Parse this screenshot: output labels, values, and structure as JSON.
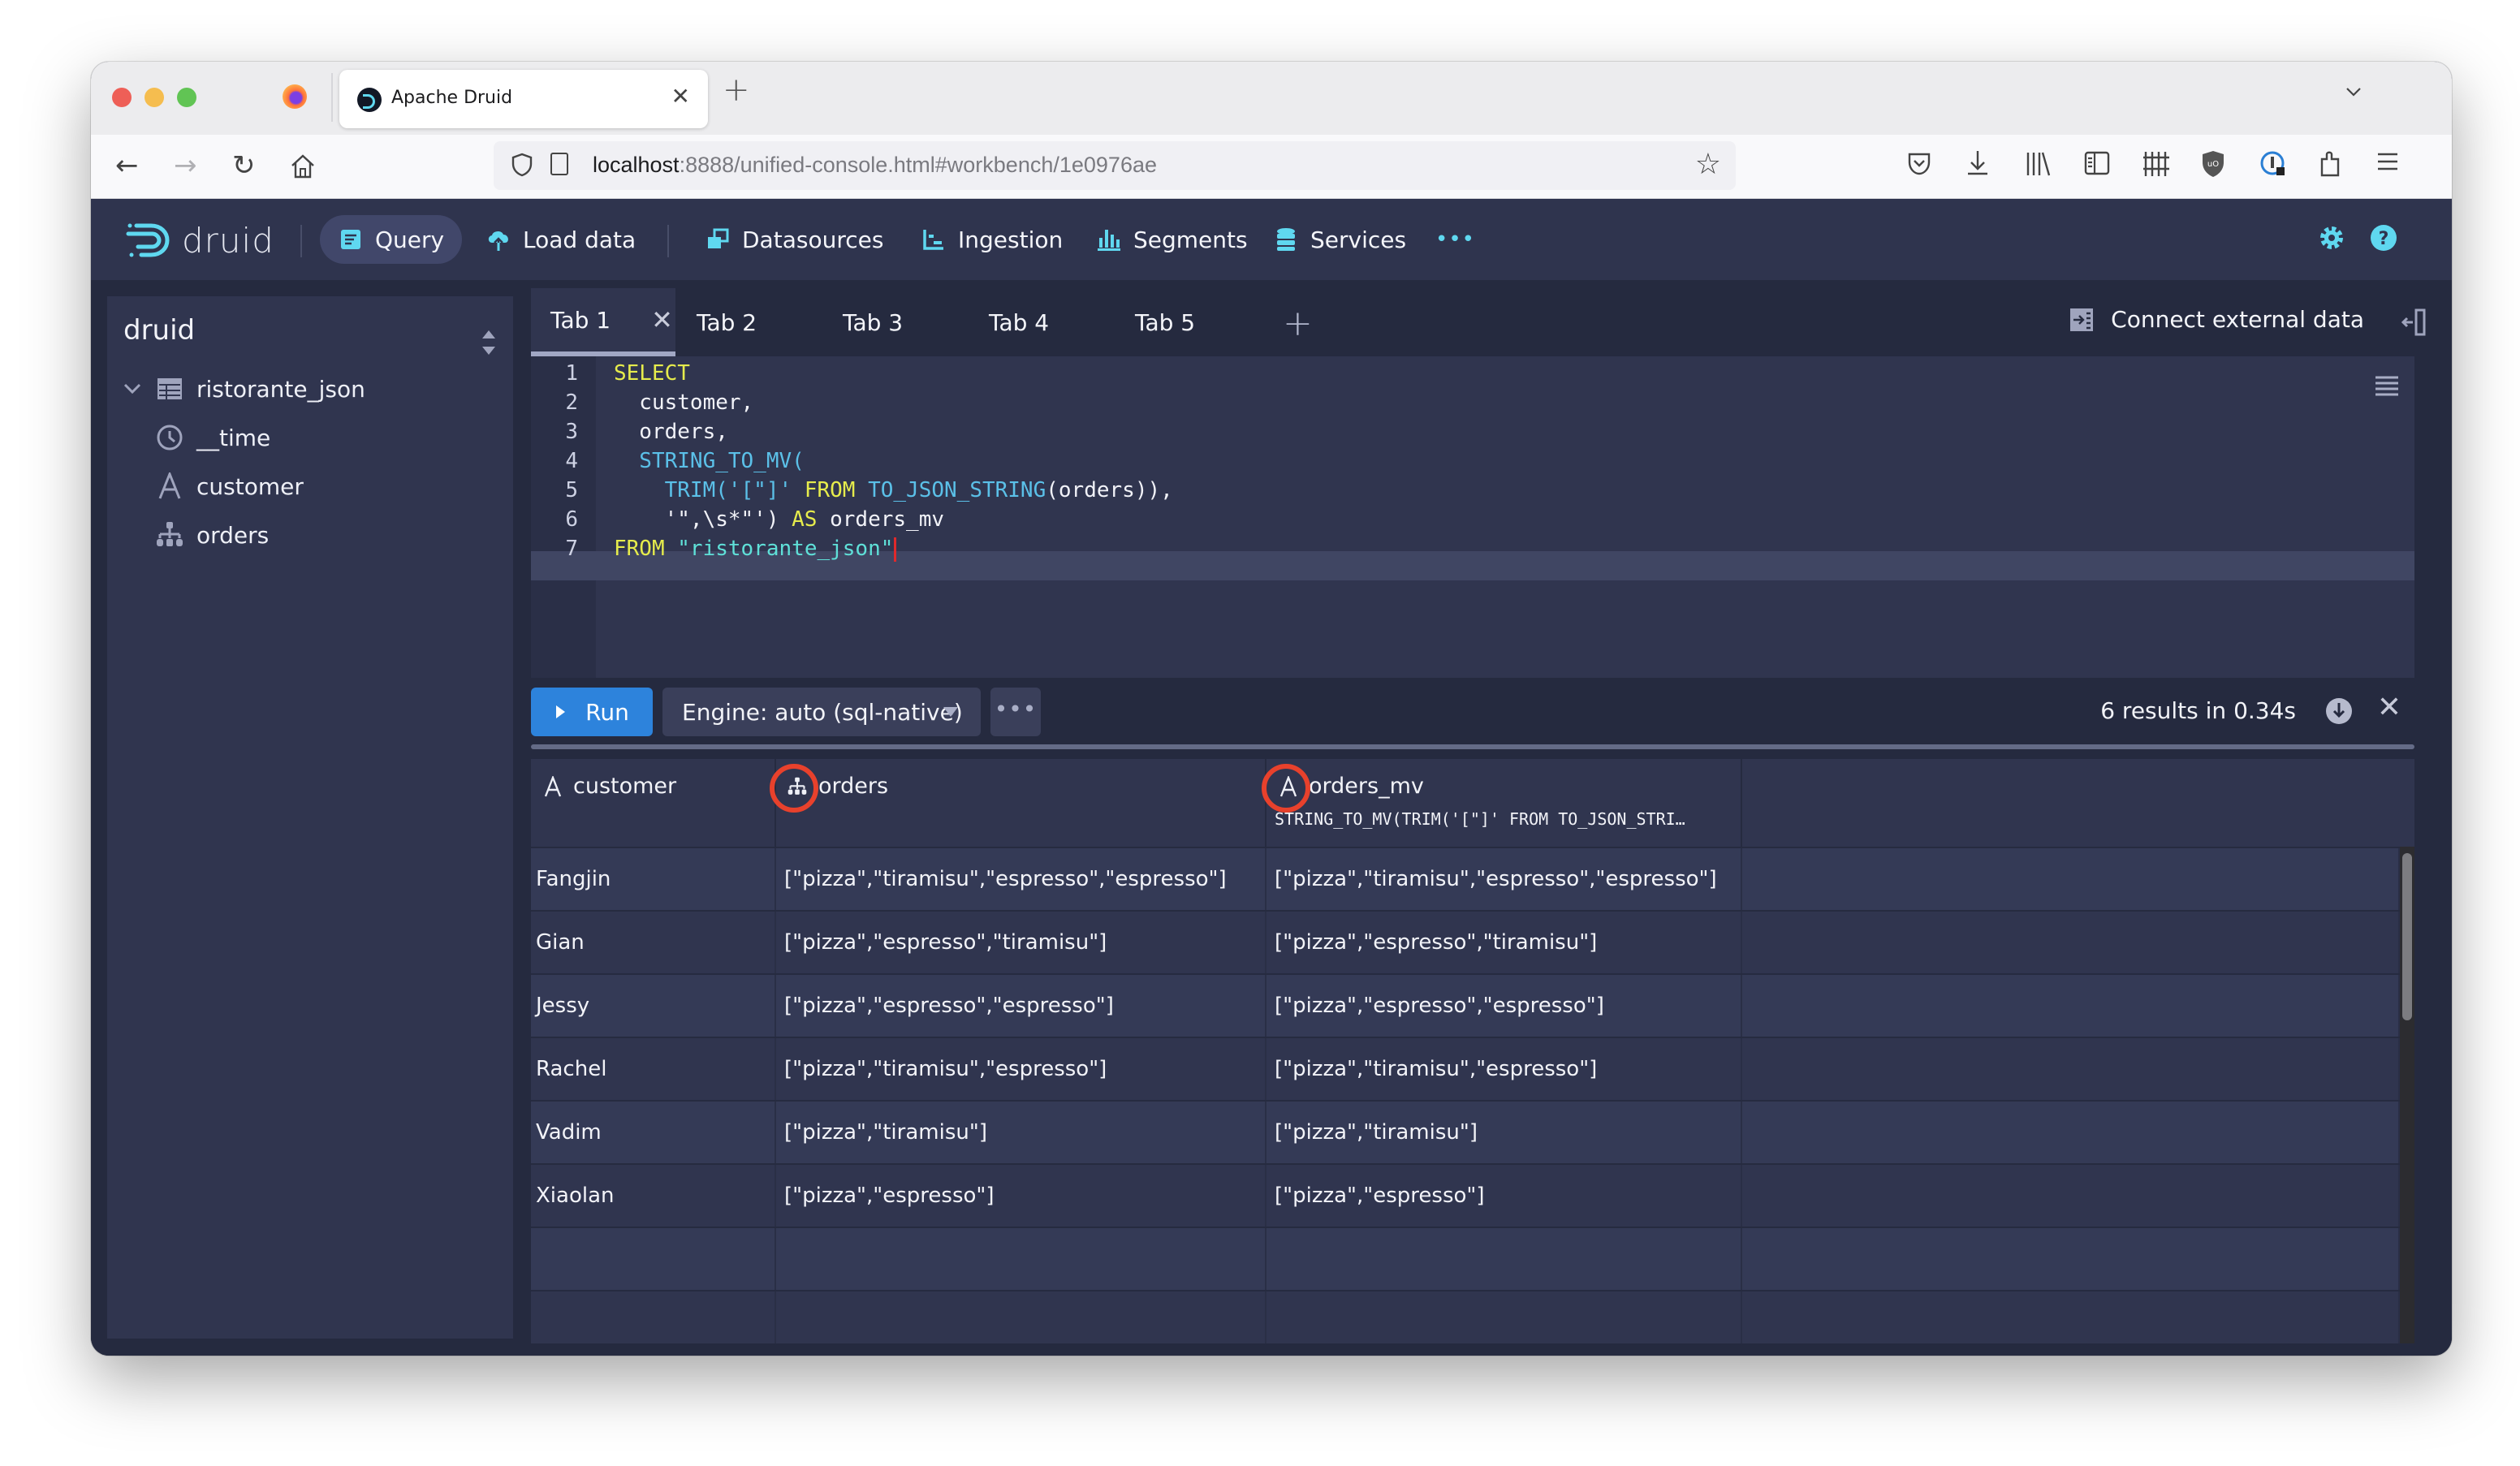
{
  "browser": {
    "tab_title": "Apache Druid",
    "new_tab_label": "+",
    "url_host": "localhost",
    "url_rest": ":8888/unified-console.html#workbench/1e0976ae"
  },
  "header": {
    "brand": "druid",
    "nav": [
      {
        "label": "Query",
        "icon": "query-icon",
        "active": true
      },
      {
        "label": "Load data",
        "icon": "upload-icon",
        "active": false
      },
      {
        "label": "Datasources",
        "icon": "datasources-icon",
        "active": false
      },
      {
        "label": "Ingestion",
        "icon": "ingestion-icon",
        "active": false
      },
      {
        "label": "Segments",
        "icon": "segments-icon",
        "active": false
      },
      {
        "label": "Services",
        "icon": "database-icon",
        "active": false
      }
    ],
    "more_label": "•••"
  },
  "sidebar": {
    "title": "druid",
    "datasource": "ristorante_json",
    "columns": [
      {
        "name": "__time",
        "type_icon": "clock-icon"
      },
      {
        "name": "customer",
        "type_icon": "string-type-icon"
      },
      {
        "name": "orders",
        "type_icon": "json-type-icon"
      }
    ]
  },
  "query_tabs": {
    "tabs": [
      "Tab 1",
      "Tab 2",
      "Tab 3",
      "Tab 4",
      "Tab 5"
    ],
    "active_index": 0,
    "close_label": "✕",
    "add_label": "+",
    "connect_label": "Connect external data"
  },
  "editor": {
    "line_numbers": [
      "1",
      "2",
      "3",
      "4",
      "5",
      "6",
      "7"
    ],
    "lines": [
      [
        {
          "t": "SELECT",
          "c": "kw"
        }
      ],
      [
        {
          "t": "  customer,",
          "c": ""
        }
      ],
      [
        {
          "t": "  orders,",
          "c": ""
        }
      ],
      [
        {
          "t": "  STRING_TO_MV(",
          "c": "fn"
        }
      ],
      [
        {
          "t": "    TRIM('[\"]' ",
          "c": "fn"
        },
        {
          "t": "FROM ",
          "c": "kw"
        },
        {
          "t": "TO_JSON_STRING",
          "c": "fn"
        },
        {
          "t": "(orders)),",
          "c": ""
        }
      ],
      [
        {
          "t": "    '\",\\s*\"') ",
          "c": ""
        },
        {
          "t": "AS ",
          "c": "kw"
        },
        {
          "t": "orders_mv",
          "c": ""
        }
      ],
      [
        {
          "t": "FROM ",
          "c": "kw"
        },
        {
          "t": "\"ristorante_json\"",
          "c": "str"
        }
      ]
    ]
  },
  "runbar": {
    "run_label": "Run",
    "engine_label": "Engine: auto (sql-native)",
    "more_label": "•••",
    "results_label": "6 results in 0.34s"
  },
  "results": {
    "columns": [
      {
        "name": "customer",
        "type_icon": "string-type-icon",
        "expr": ""
      },
      {
        "name": "orders",
        "type_icon": "json-type-icon",
        "expr": ""
      },
      {
        "name": "orders_mv",
        "type_icon": "string-type-icon",
        "expr": "STRING_TO_MV(TRIM('[\"]' FROM TO_JSON_STRI…"
      }
    ],
    "rows": [
      [
        "Fangjin",
        "[\"pizza\",\"tiramisu\",\"espresso\",\"espresso\"]",
        "[\"pizza\",\"tiramisu\",\"espresso\",\"espresso\"]"
      ],
      [
        "Gian",
        "[\"pizza\",\"espresso\",\"tiramisu\"]",
        "[\"pizza\",\"espresso\",\"tiramisu\"]"
      ],
      [
        "Jessy",
        "[\"pizza\",\"espresso\",\"espresso\"]",
        "[\"pizza\",\"espresso\",\"espresso\"]"
      ],
      [
        "Rachel",
        "[\"pizza\",\"tiramisu\",\"espresso\"]",
        "[\"pizza\",\"tiramisu\",\"espresso\"]"
      ],
      [
        "Vadim",
        "[\"pizza\",\"tiramisu\"]",
        "[\"pizza\",\"tiramisu\"]"
      ],
      [
        "Xiaolan",
        "[\"pizza\",\"espresso\"]",
        "[\"pizza\",\"espresso\"]"
      ]
    ],
    "empty_rows": 2
  },
  "colors": {
    "accent": "#5fd8f0",
    "run_button": "#2d83dc",
    "annotation": "#e8412c",
    "keyword": "#e6ec4c",
    "function": "#5bc0e8",
    "string": "#5fe0d8"
  }
}
